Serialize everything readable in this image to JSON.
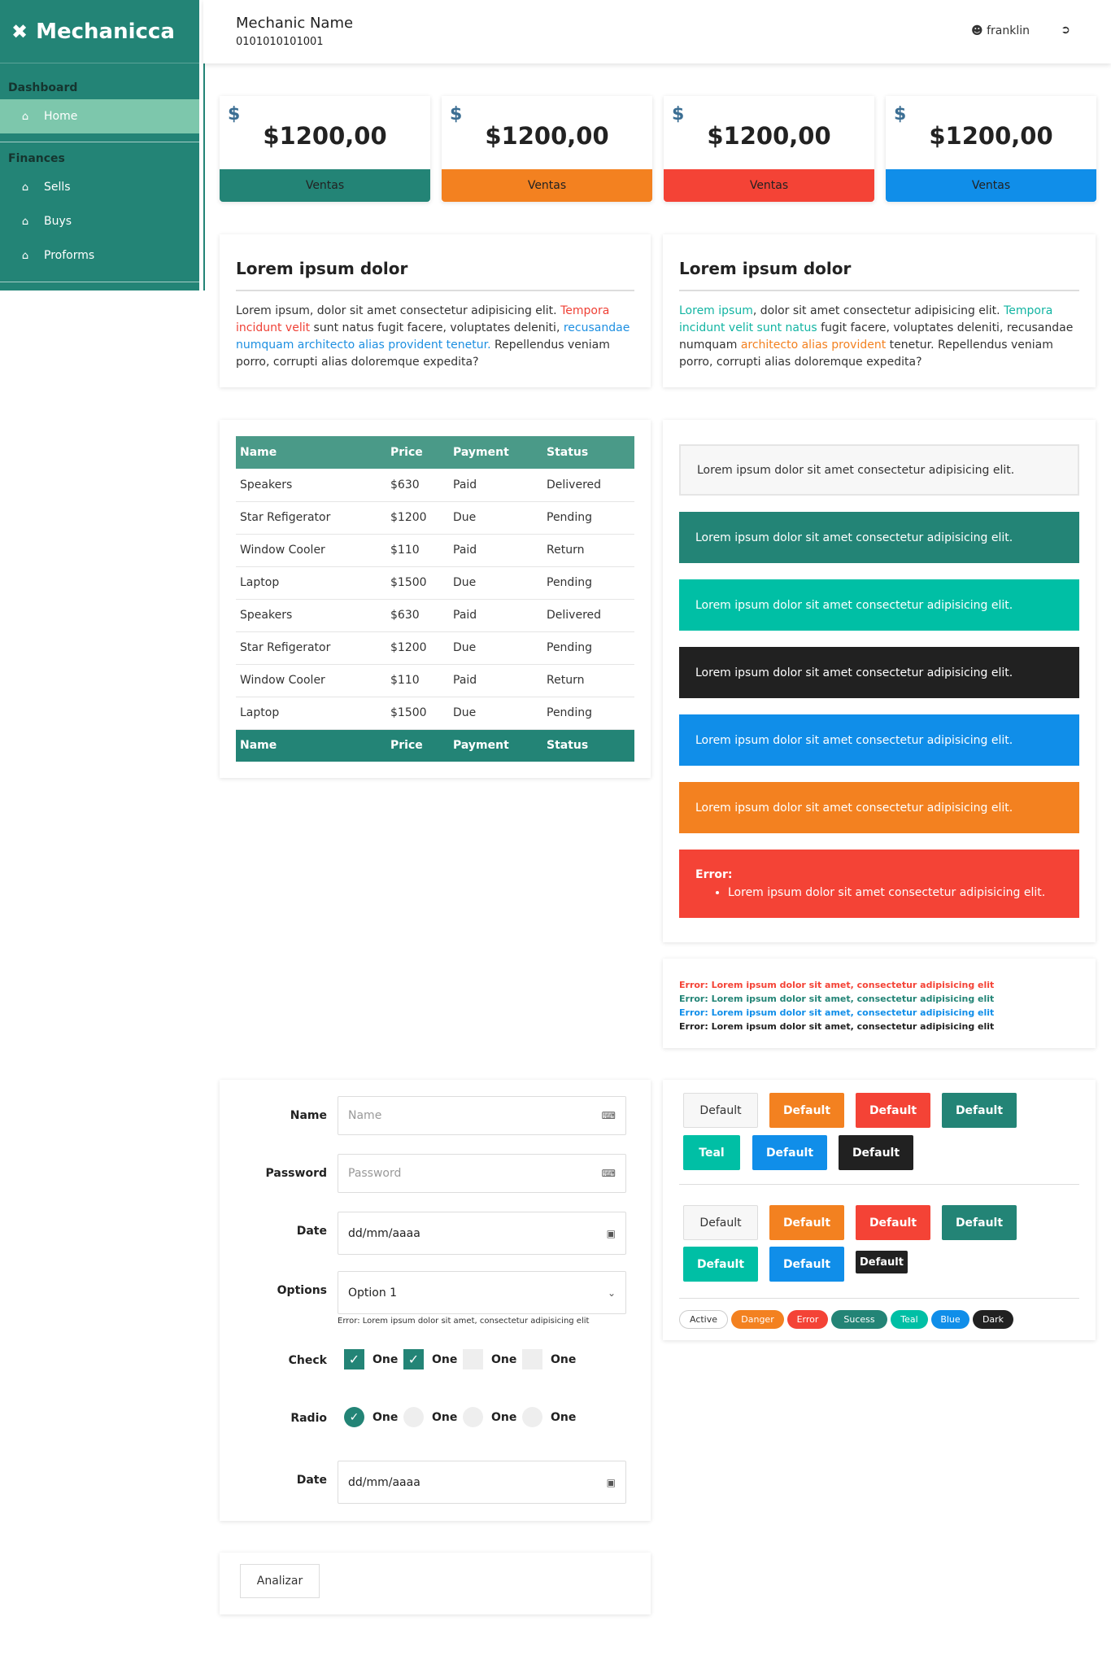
{
  "brand": {
    "name": "Mechanicca",
    "icon": "tools-icon"
  },
  "sidebar": {
    "sections": [
      {
        "title": "Dashboard",
        "items": [
          {
            "label": "Home",
            "icon": "home-icon",
            "active": true
          }
        ]
      },
      {
        "title": "Finances",
        "items": [
          {
            "label": "Sells",
            "icon": "home-icon"
          },
          {
            "label": "Buys",
            "icon": "home-icon"
          },
          {
            "label": "Proforms",
            "icon": "home-icon"
          }
        ]
      }
    ]
  },
  "header": {
    "mechanic_name": "Mechanic Name",
    "mechanic_id": "0101010101001",
    "user": "franklin",
    "user_icon": "user-icon",
    "logout_icon": "sign-out-icon"
  },
  "stats": [
    {
      "currency": "$",
      "amount": "$1200,00",
      "label": "Ventas",
      "color": "#238476"
    },
    {
      "currency": "$",
      "amount": "$1200,00",
      "label": "Ventas",
      "color": "#f38120"
    },
    {
      "currency": "$",
      "amount": "$1200,00",
      "label": "Ventas",
      "color": "#f44336"
    },
    {
      "currency": "$",
      "amount": "$1200,00",
      "label": "Ventas",
      "color": "#108ee9"
    }
  ],
  "text_cards": [
    {
      "title": "Lorem ipsum dolor",
      "parts": [
        "Lorem ipsum, dolor sit amet consectetur adipisicing elit. ",
        "Tempora incidunt velit",
        " sunt natus fugit facere, voluptates deleniti, ",
        "recusandae numquam architecto alias provident tenetur.",
        " Repellendus veniam porro, corrupti alias doloremque expedita?"
      ]
    },
    {
      "title": "Lorem ipsum dolor",
      "parts": [
        "Lorem ipsum",
        ", dolor sit amet consectetur adipisicing elit. ",
        "Tempora incidunt velit sunt natus",
        " fugit facere, voluptates deleniti, recusandae numquam ",
        "architecto alias provident",
        " tenetur. Repellendus veniam porro, corrupti alias doloremque expedita?"
      ]
    }
  ],
  "table": {
    "headers": [
      "Name",
      "Price",
      "Payment",
      "Status"
    ],
    "rows": [
      [
        "Speakers",
        "$630",
        "Paid",
        "Delivered"
      ],
      [
        "Star Refigerator",
        "$1200",
        "Due",
        "Pending"
      ],
      [
        "Window Cooler",
        "$110",
        "Paid",
        "Return"
      ],
      [
        "Laptop",
        "$1500",
        "Due",
        "Pending"
      ],
      [
        "Speakers",
        "$630",
        "Paid",
        "Delivered"
      ],
      [
        "Star Refigerator",
        "$1200",
        "Due",
        "Pending"
      ],
      [
        "Window Cooler",
        "$110",
        "Paid",
        "Return"
      ],
      [
        "Laptop",
        "$1500",
        "Due",
        "Pending"
      ]
    ]
  },
  "alerts": [
    {
      "text": "Lorem ipsum dolor sit amet consectetur adipisicing elit.",
      "style": "light"
    },
    {
      "text": "Lorem ipsum dolor sit amet consectetur adipisicing elit.",
      "color": "#238476"
    },
    {
      "text": "Lorem ipsum dolor sit amet consectetur adipisicing elit.",
      "color": "#00bfa5"
    },
    {
      "text": "Lorem ipsum dolor sit amet consectetur adipisicing elit.",
      "color": "#212121"
    },
    {
      "text": "Lorem ipsum dolor sit amet consectetur adipisicing elit.",
      "color": "#108ee9"
    },
    {
      "text": "Lorem ipsum dolor sit amet consectetur adipisicing elit.",
      "color": "#f38120"
    }
  ],
  "error_alert": {
    "title": "Error:",
    "item": "Lorem ipsum dolor sit amet consectetur adipisicing elit.",
    "color": "#f44336"
  },
  "error_lines": [
    {
      "text": "Error: Lorem ipsum dolor sit amet, consectetur adipisicing elit",
      "color": "#f44336"
    },
    {
      "text": "Error: Lorem ipsum dolor sit amet, consectetur adipisicing elit",
      "color": "#238476"
    },
    {
      "text": "Error: Lorem ipsum dolor sit amet, consectetur adipisicing elit",
      "color": "#108ee9"
    },
    {
      "text": "Error: Lorem ipsum dolor sit amet, consectetur adipisicing elit",
      "color": "#212121"
    }
  ],
  "form": {
    "name_label": "Name",
    "name_placeholder": "Name",
    "password_label": "Password",
    "password_placeholder": "Password",
    "date_label": "Date",
    "date_value": "dd/mm/aaaa",
    "options_label": "Options",
    "options_value": "Option 1",
    "options_error": "Error: Lorem ipsum dolor sit amet, consectetur adipisicing elit",
    "check_label": "Check",
    "checks": [
      {
        "label": "One",
        "checked": true
      },
      {
        "label": "One",
        "checked": true
      },
      {
        "label": "One",
        "checked": false
      },
      {
        "label": "One",
        "checked": false
      }
    ],
    "radio_label": "Radio",
    "radios": [
      {
        "label": "One",
        "checked": true
      },
      {
        "label": "One",
        "checked": false
      },
      {
        "label": "One",
        "checked": false
      },
      {
        "label": "One",
        "checked": false
      }
    ],
    "date2_label": "Date",
    "date2_value": "dd/mm/aaaa"
  },
  "analyze_button": "Analizar",
  "buttons_row1": [
    {
      "label": "Default",
      "style": "default"
    },
    {
      "label": "Default",
      "color": "#f38120"
    },
    {
      "label": "Default",
      "color": "#f44336"
    },
    {
      "label": "Default",
      "color": "#238476"
    },
    {
      "label": "Teal",
      "color": "#00bfa5"
    },
    {
      "label": "Default",
      "color": "#108ee9"
    },
    {
      "label": "Default",
      "color": "#212121"
    }
  ],
  "buttons_row2": [
    {
      "label": "Default",
      "style": "default"
    },
    {
      "label": "Default",
      "color": "#f38120"
    },
    {
      "label": "Default",
      "color": "#f44336"
    },
    {
      "label": "Default",
      "color": "#238476"
    },
    {
      "label": "Default",
      "color": "#00bfa5"
    },
    {
      "label": "Default",
      "color": "#108ee9"
    },
    {
      "label": "Default",
      "color": "#212121"
    }
  ],
  "pills": [
    {
      "label": "Active",
      "style": "light"
    },
    {
      "label": "Danger",
      "color": "#f38120"
    },
    {
      "label": "Error",
      "color": "#f44336"
    },
    {
      "label": "Sucess",
      "color": "#238476"
    },
    {
      "label": "Teal",
      "color": "#00bfa5"
    },
    {
      "label": "Blue",
      "color": "#108ee9"
    },
    {
      "label": "Dark",
      "color": "#212121"
    }
  ]
}
